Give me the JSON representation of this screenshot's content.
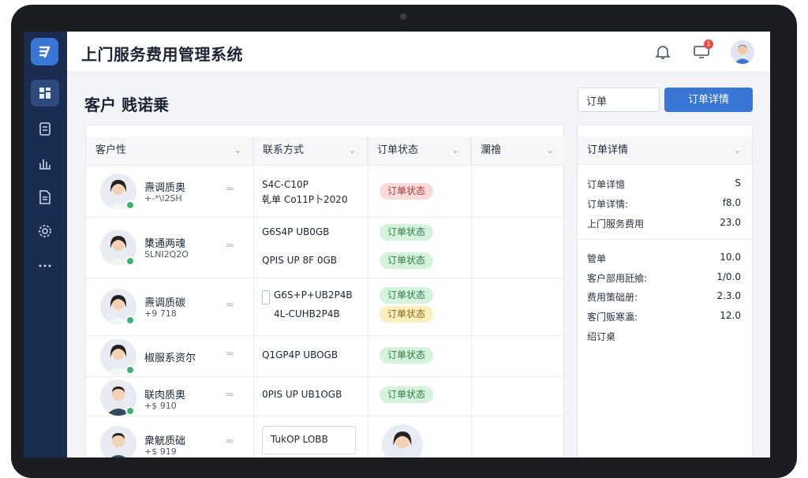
{
  "app": {
    "title": "上门服务费用管理系统",
    "notification_count": "1"
  },
  "sidebar": {
    "items": [
      "dashboard",
      "orders",
      "reports",
      "documents",
      "settings",
      "more"
    ]
  },
  "page": {
    "title": "客户 贱诺乗"
  },
  "search": {
    "value": "订单"
  },
  "primary_button": {
    "label": "订单详情"
  },
  "table": {
    "headers": [
      "客户性",
      "联系方式",
      "订单状态",
      "瀾禬"
    ],
    "rows": [
      {
        "name": "燾调质奥",
        "sub": "+-*\\l2SH",
        "contacts": [
          "S4C-C10P",
          "乹单 Co11P卜2020"
        ],
        "statuses": [
          {
            "label": "订单状态",
            "color": "red"
          }
        ]
      },
      {
        "name": "橥通两魂",
        "sub": "SLNI2Q2O",
        "contacts": [
          "G6S4P UB0GB",
          "QPIS UP 8F 0GB"
        ],
        "statuses": [
          {
            "label": "订单状态",
            "color": "green"
          },
          {
            "label": "订单状态",
            "color": "green"
          }
        ]
      },
      {
        "name": "燾调质碳",
        "sub": "+9 718",
        "contacts": [
          "G6S+P+UB2P4B",
          "4L-CUHB2P4B"
        ],
        "statuses": [
          {
            "label": "订单状态",
            "color": "green"
          },
          {
            "label": "订单状态",
            "color": "yellow"
          }
        ]
      },
      {
        "name": "椒服系资尔",
        "sub": "",
        "contacts": [
          "Q1GP4P UBOGB"
        ],
        "statuses": [
          {
            "label": "订单状态",
            "color": "green"
          }
        ]
      },
      {
        "name": "联肉质奥",
        "sub": "+$ 910",
        "contacts": [
          "0PIS UP UB1OGB"
        ],
        "statuses": [
          {
            "label": "订单状态",
            "color": "green"
          }
        ]
      },
      {
        "name": "衆觥质础",
        "sub": "+$ 919",
        "contacts": [
          "TukOP LOBB"
        ],
        "statuses": []
      }
    ]
  },
  "detail": {
    "title": "订单详情",
    "group1": [
      {
        "label": "订单详憶",
        "value": "S"
      },
      {
        "label": "订单详情:",
        "value": "f8.0"
      },
      {
        "label": "上门服务费用",
        "value": "23.0"
      }
    ],
    "group2": [
      {
        "label": "管单",
        "value": "10.0"
      },
      {
        "label": "客户部用瓩飨:",
        "value": "1/0.0"
      },
      {
        "label": "费用策础册:",
        "value": "2.3.0"
      },
      {
        "label": "客门贩寒瀛:",
        "value": "12.0"
      },
      {
        "label": "绍订桌",
        "value": ""
      }
    ]
  }
}
